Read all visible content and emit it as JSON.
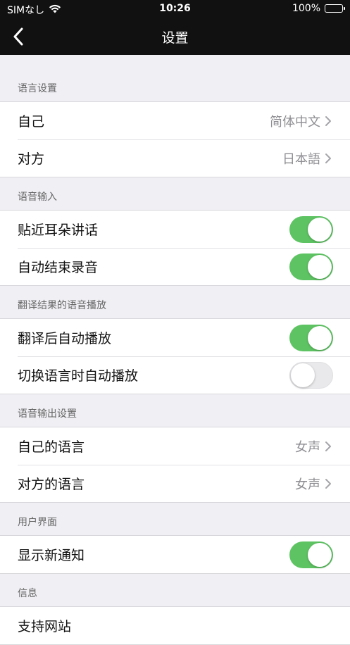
{
  "status": {
    "carrier": "SIMなし",
    "time": "10:26",
    "battery": "100%"
  },
  "nav": {
    "title": "设置"
  },
  "sections": {
    "language": {
      "header": "语言设置",
      "self": {
        "label": "自己",
        "value": "简体中文"
      },
      "partner": {
        "label": "对方",
        "value": "日本語"
      }
    },
    "voice_input": {
      "header": "语音输入",
      "ear": {
        "label": "贴近耳朵讲话",
        "on": true
      },
      "auto_end": {
        "label": "自动结束录音",
        "on": true
      }
    },
    "playback": {
      "header": "翻译结果的语音播放",
      "after_translate": {
        "label": "翻译后自动播放",
        "on": true
      },
      "on_switch": {
        "label": "切换语言时自动播放",
        "on": false
      }
    },
    "voice_output": {
      "header": "语音输出设置",
      "self_lang": {
        "label": "自己的语言",
        "value": "女声"
      },
      "partner_lang": {
        "label": "对方的语言",
        "value": "女声"
      }
    },
    "ui": {
      "header": "用户界面",
      "notifications": {
        "label": "显示新通知",
        "on": true
      }
    },
    "info": {
      "header": "信息",
      "support": {
        "label": "支持网站"
      }
    }
  },
  "colors": {
    "toggle_on": "#5ec463",
    "toggle_off": "#e9e9eb",
    "bar": "#111111"
  }
}
